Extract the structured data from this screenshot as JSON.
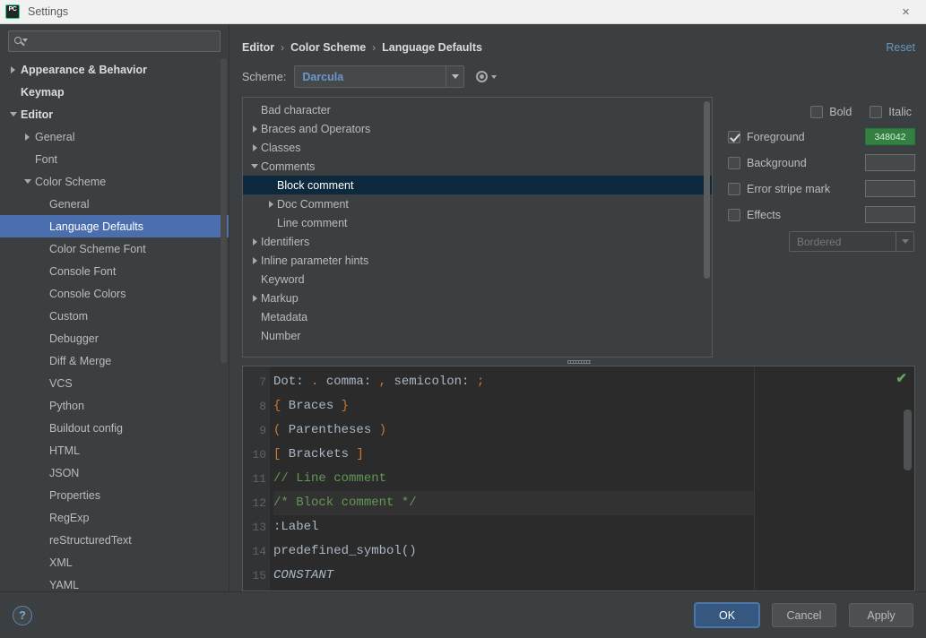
{
  "window": {
    "title": "Settings",
    "logo_text": "PC",
    "close_icon": "×"
  },
  "sidebar": {
    "search": {
      "value": "",
      "placeholder": ""
    },
    "items": [
      {
        "label": "Appearance & Behavior",
        "arrow": "right",
        "indent": 0,
        "bold": true,
        "selected": false
      },
      {
        "label": "Keymap",
        "arrow": "none",
        "indent": 0,
        "bold": true,
        "selected": false
      },
      {
        "label": "Editor",
        "arrow": "down",
        "indent": 0,
        "bold": true,
        "selected": false
      },
      {
        "label": "General",
        "arrow": "right",
        "indent": 1,
        "bold": false,
        "selected": false
      },
      {
        "label": "Font",
        "arrow": "none",
        "indent": 1,
        "bold": false,
        "selected": false
      },
      {
        "label": "Color Scheme",
        "arrow": "down",
        "indent": 1,
        "bold": false,
        "selected": false
      },
      {
        "label": "General",
        "arrow": "none",
        "indent": 2,
        "bold": false,
        "selected": false
      },
      {
        "label": "Language Defaults",
        "arrow": "none",
        "indent": 2,
        "bold": false,
        "selected": true
      },
      {
        "label": "Color Scheme Font",
        "arrow": "none",
        "indent": 2,
        "bold": false,
        "selected": false
      },
      {
        "label": "Console Font",
        "arrow": "none",
        "indent": 2,
        "bold": false,
        "selected": false
      },
      {
        "label": "Console Colors",
        "arrow": "none",
        "indent": 2,
        "bold": false,
        "selected": false
      },
      {
        "label": "Custom",
        "arrow": "none",
        "indent": 2,
        "bold": false,
        "selected": false
      },
      {
        "label": "Debugger",
        "arrow": "none",
        "indent": 2,
        "bold": false,
        "selected": false
      },
      {
        "label": "Diff & Merge",
        "arrow": "none",
        "indent": 2,
        "bold": false,
        "selected": false
      },
      {
        "label": "VCS",
        "arrow": "none",
        "indent": 2,
        "bold": false,
        "selected": false
      },
      {
        "label": "Python",
        "arrow": "none",
        "indent": 2,
        "bold": false,
        "selected": false
      },
      {
        "label": "Buildout config",
        "arrow": "none",
        "indent": 2,
        "bold": false,
        "selected": false
      },
      {
        "label": "HTML",
        "arrow": "none",
        "indent": 2,
        "bold": false,
        "selected": false
      },
      {
        "label": "JSON",
        "arrow": "none",
        "indent": 2,
        "bold": false,
        "selected": false
      },
      {
        "label": "Properties",
        "arrow": "none",
        "indent": 2,
        "bold": false,
        "selected": false
      },
      {
        "label": "RegExp",
        "arrow": "none",
        "indent": 2,
        "bold": false,
        "selected": false
      },
      {
        "label": "reStructuredText",
        "arrow": "none",
        "indent": 2,
        "bold": false,
        "selected": false
      },
      {
        "label": "XML",
        "arrow": "none",
        "indent": 2,
        "bold": false,
        "selected": false
      },
      {
        "label": "YAML",
        "arrow": "none",
        "indent": 2,
        "bold": false,
        "selected": false
      }
    ]
  },
  "header": {
    "breadcrumb": [
      "Editor",
      "Color Scheme",
      "Language Defaults"
    ],
    "separator": "›",
    "reset_label": "Reset"
  },
  "scheme": {
    "label": "Scheme:",
    "value": "Darcula",
    "gear_icon": "gear-icon"
  },
  "attributes": {
    "items": [
      {
        "label": "Bad character",
        "arrow": "none",
        "indent": 0,
        "selected": false
      },
      {
        "label": "Braces and Operators",
        "arrow": "right",
        "indent": 0,
        "selected": false
      },
      {
        "label": "Classes",
        "arrow": "right",
        "indent": 0,
        "selected": false
      },
      {
        "label": "Comments",
        "arrow": "down",
        "indent": 0,
        "selected": false
      },
      {
        "label": "Block comment",
        "arrow": "none",
        "indent": 1,
        "selected": true
      },
      {
        "label": "Doc Comment",
        "arrow": "right",
        "indent": 1,
        "selected": false
      },
      {
        "label": "Line comment",
        "arrow": "none",
        "indent": 1,
        "selected": false
      },
      {
        "label": "Identifiers",
        "arrow": "right",
        "indent": 0,
        "selected": false
      },
      {
        "label": "Inline parameter hints",
        "arrow": "right",
        "indent": 0,
        "selected": false
      },
      {
        "label": "Keyword",
        "arrow": "none",
        "indent": 0,
        "selected": false
      },
      {
        "label": "Markup",
        "arrow": "right",
        "indent": 0,
        "selected": false
      },
      {
        "label": "Metadata",
        "arrow": "none",
        "indent": 0,
        "selected": false
      },
      {
        "label": "Number",
        "arrow": "none",
        "indent": 0,
        "selected": false
      }
    ]
  },
  "properties": {
    "bold_label": "Bold",
    "bold_checked": false,
    "italic_label": "Italic",
    "italic_checked": false,
    "foreground_label": "Foreground",
    "foreground_checked": true,
    "foreground_color": "348042",
    "background_label": "Background",
    "background_checked": false,
    "background_color": "",
    "error_stripe_label": "Error stripe mark",
    "error_stripe_checked": false,
    "error_stripe_color": "",
    "effects_label": "Effects",
    "effects_checked": false,
    "effects_color": "",
    "effect_type": "Bordered"
  },
  "preview": {
    "inspection_icon": "✔",
    "lines": [
      {
        "num": "7",
        "highlight": false,
        "segments": [
          {
            "text": "Dot: ",
            "style": "plain"
          },
          {
            "text": ".",
            "style": "punct"
          },
          {
            "text": " comma: ",
            "style": "plain"
          },
          {
            "text": ",",
            "style": "punct"
          },
          {
            "text": " semicolon: ",
            "style": "plain"
          },
          {
            "text": ";",
            "style": "punct"
          }
        ]
      },
      {
        "num": "8",
        "highlight": false,
        "segments": [
          {
            "text": "{",
            "style": "punct"
          },
          {
            "text": " Braces ",
            "style": "plain"
          },
          {
            "text": "}",
            "style": "punct"
          }
        ]
      },
      {
        "num": "9",
        "highlight": false,
        "segments": [
          {
            "text": "(",
            "style": "punct"
          },
          {
            "text": " Parentheses ",
            "style": "plain"
          },
          {
            "text": ")",
            "style": "punct"
          }
        ]
      },
      {
        "num": "10",
        "highlight": false,
        "segments": [
          {
            "text": "[",
            "style": "punct"
          },
          {
            "text": " Brackets ",
            "style": "plain"
          },
          {
            "text": "]",
            "style": "punct"
          }
        ]
      },
      {
        "num": "11",
        "highlight": false,
        "segments": [
          {
            "text": "// Line comment",
            "style": "comment"
          }
        ]
      },
      {
        "num": "12",
        "highlight": true,
        "segments": [
          {
            "text": "/* Block comment */",
            "style": "comment"
          }
        ]
      },
      {
        "num": "13",
        "highlight": false,
        "segments": [
          {
            "text": ":Label",
            "style": "plain"
          }
        ]
      },
      {
        "num": "14",
        "highlight": false,
        "segments": [
          {
            "text": "predefined_symbol()",
            "style": "plain"
          }
        ]
      },
      {
        "num": "15",
        "highlight": false,
        "segments": [
          {
            "text": "CONSTANT",
            "style": "italic"
          }
        ]
      }
    ]
  },
  "footer": {
    "help_label": "?",
    "ok_label": "OK",
    "cancel_label": "Cancel",
    "apply_label": "Apply"
  }
}
